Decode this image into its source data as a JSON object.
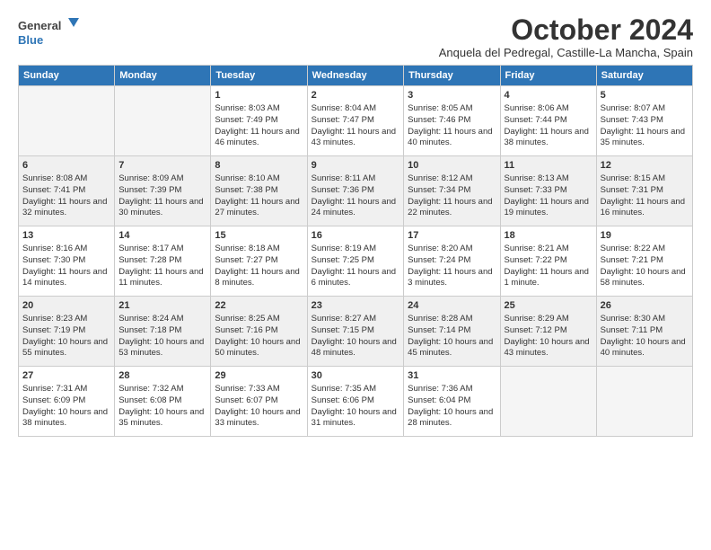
{
  "logo": {
    "line1": "General",
    "line2": "Blue"
  },
  "title": "October 2024",
  "location": "Anquela del Pedregal, Castille-La Mancha, Spain",
  "days_header": [
    "Sunday",
    "Monday",
    "Tuesday",
    "Wednesday",
    "Thursday",
    "Friday",
    "Saturday"
  ],
  "weeks": [
    [
      {
        "day": "",
        "empty": true
      },
      {
        "day": "",
        "empty": true
      },
      {
        "day": "1",
        "sunrise": "Sunrise: 8:03 AM",
        "sunset": "Sunset: 7:49 PM",
        "daylight": "Daylight: 11 hours and 46 minutes."
      },
      {
        "day": "2",
        "sunrise": "Sunrise: 8:04 AM",
        "sunset": "Sunset: 7:47 PM",
        "daylight": "Daylight: 11 hours and 43 minutes."
      },
      {
        "day": "3",
        "sunrise": "Sunrise: 8:05 AM",
        "sunset": "Sunset: 7:46 PM",
        "daylight": "Daylight: 11 hours and 40 minutes."
      },
      {
        "day": "4",
        "sunrise": "Sunrise: 8:06 AM",
        "sunset": "Sunset: 7:44 PM",
        "daylight": "Daylight: 11 hours and 38 minutes."
      },
      {
        "day": "5",
        "sunrise": "Sunrise: 8:07 AM",
        "sunset": "Sunset: 7:43 PM",
        "daylight": "Daylight: 11 hours and 35 minutes."
      }
    ],
    [
      {
        "day": "6",
        "sunrise": "Sunrise: 8:08 AM",
        "sunset": "Sunset: 7:41 PM",
        "daylight": "Daylight: 11 hours and 32 minutes."
      },
      {
        "day": "7",
        "sunrise": "Sunrise: 8:09 AM",
        "sunset": "Sunset: 7:39 PM",
        "daylight": "Daylight: 11 hours and 30 minutes."
      },
      {
        "day": "8",
        "sunrise": "Sunrise: 8:10 AM",
        "sunset": "Sunset: 7:38 PM",
        "daylight": "Daylight: 11 hours and 27 minutes."
      },
      {
        "day": "9",
        "sunrise": "Sunrise: 8:11 AM",
        "sunset": "Sunset: 7:36 PM",
        "daylight": "Daylight: 11 hours and 24 minutes."
      },
      {
        "day": "10",
        "sunrise": "Sunrise: 8:12 AM",
        "sunset": "Sunset: 7:34 PM",
        "daylight": "Daylight: 11 hours and 22 minutes."
      },
      {
        "day": "11",
        "sunrise": "Sunrise: 8:13 AM",
        "sunset": "Sunset: 7:33 PM",
        "daylight": "Daylight: 11 hours and 19 minutes."
      },
      {
        "day": "12",
        "sunrise": "Sunrise: 8:15 AM",
        "sunset": "Sunset: 7:31 PM",
        "daylight": "Daylight: 11 hours and 16 minutes."
      }
    ],
    [
      {
        "day": "13",
        "sunrise": "Sunrise: 8:16 AM",
        "sunset": "Sunset: 7:30 PM",
        "daylight": "Daylight: 11 hours and 14 minutes."
      },
      {
        "day": "14",
        "sunrise": "Sunrise: 8:17 AM",
        "sunset": "Sunset: 7:28 PM",
        "daylight": "Daylight: 11 hours and 11 minutes."
      },
      {
        "day": "15",
        "sunrise": "Sunrise: 8:18 AM",
        "sunset": "Sunset: 7:27 PM",
        "daylight": "Daylight: 11 hours and 8 minutes."
      },
      {
        "day": "16",
        "sunrise": "Sunrise: 8:19 AM",
        "sunset": "Sunset: 7:25 PM",
        "daylight": "Daylight: 11 hours and 6 minutes."
      },
      {
        "day": "17",
        "sunrise": "Sunrise: 8:20 AM",
        "sunset": "Sunset: 7:24 PM",
        "daylight": "Daylight: 11 hours and 3 minutes."
      },
      {
        "day": "18",
        "sunrise": "Sunrise: 8:21 AM",
        "sunset": "Sunset: 7:22 PM",
        "daylight": "Daylight: 11 hours and 1 minute."
      },
      {
        "day": "19",
        "sunrise": "Sunrise: 8:22 AM",
        "sunset": "Sunset: 7:21 PM",
        "daylight": "Daylight: 10 hours and 58 minutes."
      }
    ],
    [
      {
        "day": "20",
        "sunrise": "Sunrise: 8:23 AM",
        "sunset": "Sunset: 7:19 PM",
        "daylight": "Daylight: 10 hours and 55 minutes."
      },
      {
        "day": "21",
        "sunrise": "Sunrise: 8:24 AM",
        "sunset": "Sunset: 7:18 PM",
        "daylight": "Daylight: 10 hours and 53 minutes."
      },
      {
        "day": "22",
        "sunrise": "Sunrise: 8:25 AM",
        "sunset": "Sunset: 7:16 PM",
        "daylight": "Daylight: 10 hours and 50 minutes."
      },
      {
        "day": "23",
        "sunrise": "Sunrise: 8:27 AM",
        "sunset": "Sunset: 7:15 PM",
        "daylight": "Daylight: 10 hours and 48 minutes."
      },
      {
        "day": "24",
        "sunrise": "Sunrise: 8:28 AM",
        "sunset": "Sunset: 7:14 PM",
        "daylight": "Daylight: 10 hours and 45 minutes."
      },
      {
        "day": "25",
        "sunrise": "Sunrise: 8:29 AM",
        "sunset": "Sunset: 7:12 PM",
        "daylight": "Daylight: 10 hours and 43 minutes."
      },
      {
        "day": "26",
        "sunrise": "Sunrise: 8:30 AM",
        "sunset": "Sunset: 7:11 PM",
        "daylight": "Daylight: 10 hours and 40 minutes."
      }
    ],
    [
      {
        "day": "27",
        "sunrise": "Sunrise: 7:31 AM",
        "sunset": "Sunset: 6:09 PM",
        "daylight": "Daylight: 10 hours and 38 minutes."
      },
      {
        "day": "28",
        "sunrise": "Sunrise: 7:32 AM",
        "sunset": "Sunset: 6:08 PM",
        "daylight": "Daylight: 10 hours and 35 minutes."
      },
      {
        "day": "29",
        "sunrise": "Sunrise: 7:33 AM",
        "sunset": "Sunset: 6:07 PM",
        "daylight": "Daylight: 10 hours and 33 minutes."
      },
      {
        "day": "30",
        "sunrise": "Sunrise: 7:35 AM",
        "sunset": "Sunset: 6:06 PM",
        "daylight": "Daylight: 10 hours and 31 minutes."
      },
      {
        "day": "31",
        "sunrise": "Sunrise: 7:36 AM",
        "sunset": "Sunset: 6:04 PM",
        "daylight": "Daylight: 10 hours and 28 minutes."
      },
      {
        "day": "",
        "empty": true
      },
      {
        "day": "",
        "empty": true
      }
    ]
  ]
}
